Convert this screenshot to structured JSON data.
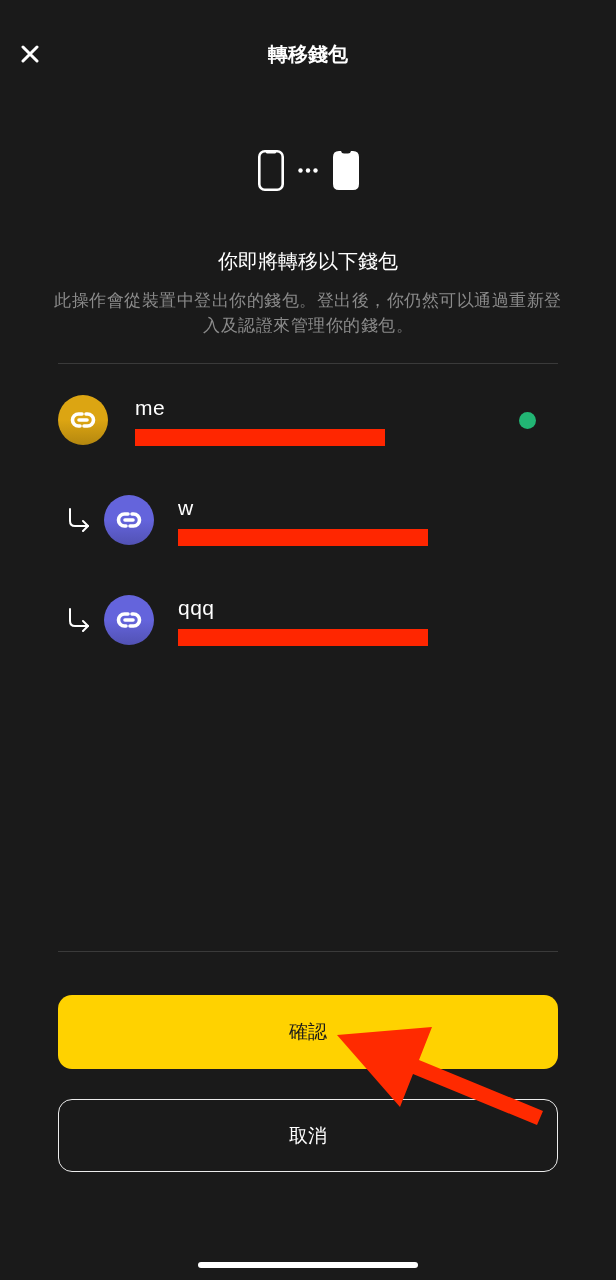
{
  "header": {
    "title": "轉移錢包"
  },
  "heading": "你即將轉移以下錢包",
  "description": "此操作會從裝置中登出你的錢包。登出後，你仍然可以通過重新登入及認證來管理你的錢包。",
  "wallets": [
    {
      "name": "me",
      "color": "#dca512",
      "active": true,
      "redacted": true,
      "children": [
        {
          "name": "w",
          "color": "#6464dc",
          "active": false,
          "redacted": true
        },
        {
          "name": "qqq",
          "color": "#6464dc",
          "active": false,
          "redacted": true
        }
      ]
    }
  ],
  "buttons": [
    {
      "label": "確認",
      "kind": "primary"
    },
    {
      "label": "取消",
      "kind": "secondary"
    }
  ],
  "annotation_arrow": true
}
